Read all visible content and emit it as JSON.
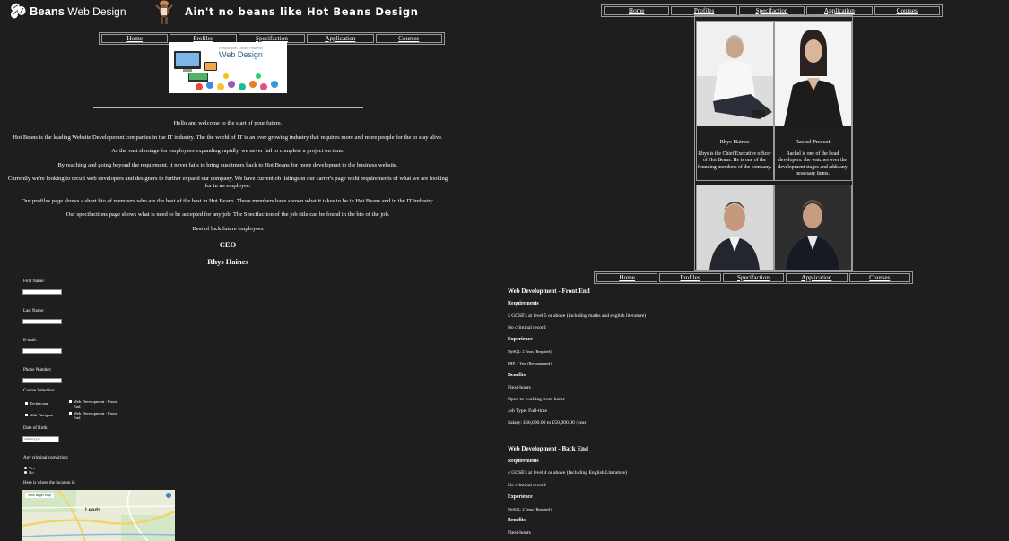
{
  "header": {
    "logo_bold": "Beans",
    "logo_text": "Web Design",
    "tagline": "Ain't no beans like Hot Beans Design"
  },
  "nav": [
    "Home",
    "Profiles",
    "Specifaction",
    "Application",
    "Courses"
  ],
  "banner": {
    "line1": "Responsive, Clean, Powerful",
    "title": "Web Design"
  },
  "intro": {
    "p1": "Hello and welcome to the start of your future.",
    "p2": "Hot Beans is the leading Website Developemnt companies in the IT industry. The the world of IT is an ever growing industry that requires more and more people for the to stay alive.",
    "p3": "As the vast shortage for employees expanding rapidly, we never fail to complete a project on time.",
    "p4": "By reaching and going beyond the requirment, it never fails to bring cusotmers back to Hot Beans for more developmet to the business website.",
    "p5": "Currently we're looking to recuit web developers and designers to further expand our company. We have currentjob listingson our carrer's page woht requirements of what we are looking for in an employee.",
    "p6": "Our profiles page shows a short bio of members who are the best of the best in Hot Beans. These members have shown what it takes to be in Hot Beans and in the IT industry.",
    "p7": "Our specifactions page shows what is need to be accepted for any job. The Specifaction of the job title can be found in the bio of the job.",
    "p8": "Best of luck future employees",
    "ceo_title": "CEO",
    "ceo_name": "Rhys Haines"
  },
  "form": {
    "first_name": "First Name:",
    "last_name": "Last Name:",
    "email": "E-mail:",
    "phone": "Phone Number:",
    "course_selection": "Course Selection:",
    "opt_technician": "Technician",
    "opt_web_designer": "Web Designer",
    "opt_front_end_1": "Web Development - Front End",
    "opt_front_end_2": "Web Development - Front End",
    "dob_label": "Date of Birth:",
    "dob_placeholder": "dd/mm/yyyy",
    "conviction_label": "Any criminal conviction:",
    "yes": "Yes",
    "no": "No",
    "location_label": "Here is where the location is:",
    "map_button": "View larger map",
    "map_city": "Leeds"
  },
  "profiles": [
    {
      "name": "Rhys Haines",
      "bio": "Rhys is the Chief Executive officer of Hot Beans. He is one of the founding members of the company."
    },
    {
      "name": "Rachel Prescot",
      "bio": "Rachel is one of the head developers. she watches over the development stages and adds any nessesary items."
    }
  ],
  "courses": [
    {
      "title": "Web Development - Front End",
      "req_label": "Requirements",
      "req": [
        "5 GCSE's at level 5 or above (including maths and english literature)",
        "No criminal record"
      ],
      "exp_label": "Experience",
      "exp": [
        "MySQL: 2 Years (Required)",
        "PHP: 1 Year (Recommened)"
      ],
      "ben_label": "Benefits",
      "ben": [
        "Flexi-hours",
        "Open to working from home",
        "Job Type: Full-time",
        "Salary: £36,000.00 to £50,000.00 /year"
      ]
    },
    {
      "title": "Web Development - Back End",
      "req_label": "Requirements",
      "req": [
        "4 GCSE's at level 4 or above (Including English Literature)",
        "No criminal record"
      ],
      "exp_label": "Experience",
      "exp": [
        "MySQL: 2 Years (Required)"
      ],
      "ben_label": "Benefits",
      "ben": [
        "Flexi-hours"
      ]
    }
  ]
}
